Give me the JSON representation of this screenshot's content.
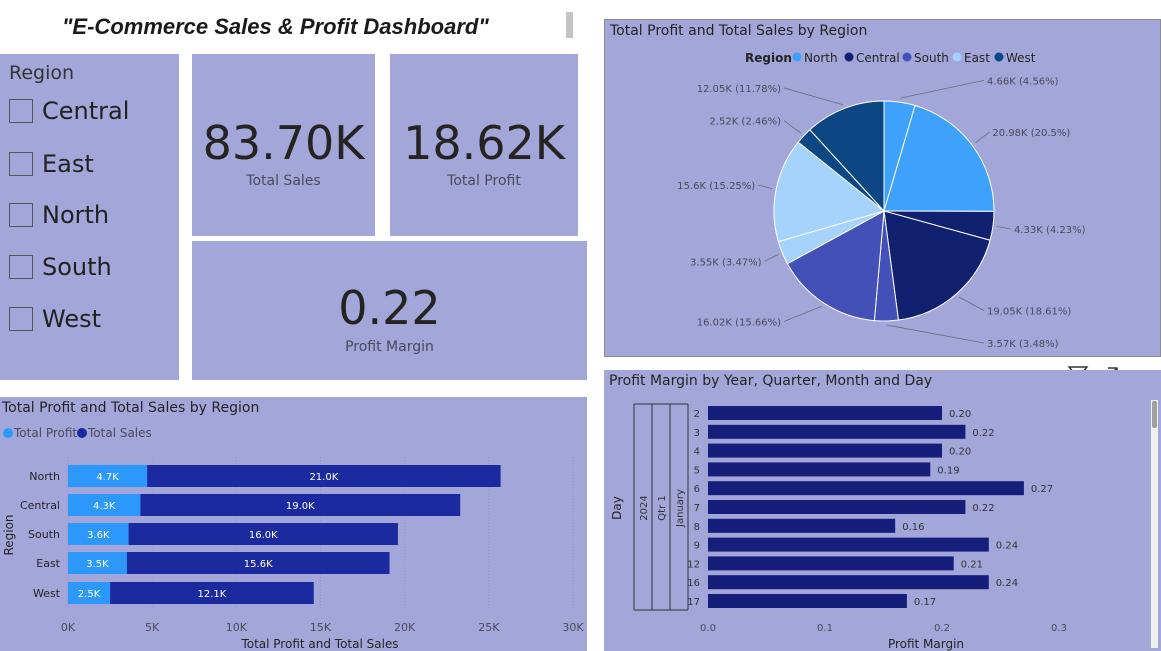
{
  "dashboard_title": "\"E-Commerce Sales & Profit Dashboard\"",
  "slicer": {
    "header": "Region",
    "items": [
      "Central",
      "East",
      "North",
      "South",
      "West"
    ]
  },
  "cards": {
    "total_sales": {
      "value": "83.70K",
      "label": "Total Sales"
    },
    "total_profit": {
      "value": "18.62K",
      "label": "Total Profit"
    },
    "profit_margin": {
      "value": "0.22",
      "label": "Profit Margin"
    }
  },
  "colors": {
    "panel_bg": "#a3a6d9",
    "north": "#3ea1fb",
    "central": "#12216f",
    "south": "#4350b7",
    "east": "#a6d3fc",
    "west": "#0d4783",
    "profit_bar": "#2c98fb",
    "sales_bar": "#1c2aa0",
    "margin_bar": "#151e7a"
  },
  "visual_header_icons": [
    "filter-icon",
    "focus-mode-icon",
    "more-options-icon"
  ],
  "chart_data": [
    {
      "type": "pie",
      "title": "Total Profit and Total Sales by Region",
      "legend_title": "Region",
      "legend_position": "top-center",
      "legend": [
        "North",
        "Central",
        "South",
        "East",
        "West"
      ],
      "slices": [
        {
          "region": "North",
          "measure": "Total Profit",
          "value": 4.66,
          "label": "4.66K (4.56%)",
          "color": "#3ea1fb"
        },
        {
          "region": "North",
          "measure": "Total Sales",
          "value": 20.98,
          "label": "20.98K (20.5%)",
          "color": "#3ea1fb"
        },
        {
          "region": "Central",
          "measure": "Total Profit",
          "value": 4.33,
          "label": "4.33K (4.23%)",
          "color": "#12216f"
        },
        {
          "region": "Central",
          "measure": "Total Sales",
          "value": 19.05,
          "label": "19.05K (18.61%)",
          "color": "#12216f"
        },
        {
          "region": "South",
          "measure": "Total Profit",
          "value": 3.57,
          "label": "3.57K (3.48%)",
          "color": "#4350b7"
        },
        {
          "region": "South",
          "measure": "Total Sales",
          "value": 16.02,
          "label": "16.02K (15.66%)",
          "color": "#4350b7"
        },
        {
          "region": "East",
          "measure": "Total Profit",
          "value": 3.55,
          "label": "3.55K (3.47%)",
          "color": "#a6d3fc"
        },
        {
          "region": "East",
          "measure": "Total Sales",
          "value": 15.6,
          "label": "15.6K (15.25%)",
          "color": "#a6d3fc"
        },
        {
          "region": "West",
          "measure": "Total Profit",
          "value": 2.52,
          "label": "2.52K (2.46%)",
          "color": "#0d4783"
        },
        {
          "region": "West",
          "measure": "Total Sales",
          "value": 12.05,
          "label": "12.05K (11.78%)",
          "color": "#0d4783"
        }
      ]
    },
    {
      "type": "bar",
      "orientation": "horizontal-stacked",
      "title": "Total Profit and Total Sales by Region",
      "legend_position": "top-left",
      "categories": [
        "North",
        "Central",
        "South",
        "East",
        "West"
      ],
      "series": [
        {
          "name": "Total Profit",
          "values": [
            4.7,
            4.3,
            3.6,
            3.5,
            2.5
          ],
          "labels": [
            "4.7K",
            "4.3K",
            "3.6K",
            "3.5K",
            "2.5K"
          ],
          "color": "#2c98fb"
        },
        {
          "name": "Total Sales",
          "values": [
            21.0,
            19.0,
            16.0,
            15.6,
            12.1
          ],
          "labels": [
            "21.0K",
            "19.0K",
            "16.0K",
            "15.6K",
            "12.1K"
          ],
          "color": "#1c2aa0"
        }
      ],
      "xlabel": "Total Profit and Total Sales",
      "ylabel": "Region",
      "xlim": [
        0,
        30
      ],
      "xticks": [
        "0K",
        "5K",
        "10K",
        "15K",
        "20K",
        "25K",
        "30K"
      ]
    },
    {
      "type": "bar",
      "orientation": "horizontal",
      "title": "Profit Margin by Year, Quarter, Month and Day",
      "ylabel": "Day",
      "hierarchy": {
        "year": "2024",
        "quarter": "Qtr 1",
        "month": "January"
      },
      "categories": [
        "2",
        "3",
        "4",
        "5",
        "6",
        "7",
        "8",
        "9",
        "12",
        "16",
        "17"
      ],
      "values": [
        0.2,
        0.22,
        0.2,
        0.19,
        0.27,
        0.22,
        0.16,
        0.24,
        0.21,
        0.24,
        0.17
      ],
      "labels": [
        "0.20",
        "0.22",
        "0.20",
        "0.19",
        "0.27",
        "0.22",
        "0.16",
        "0.24",
        "0.21",
        "0.24",
        "0.17"
      ],
      "xlabel": "Profit Margin",
      "xlim": [
        0,
        0.3
      ],
      "xticks": [
        "0.0",
        "0.1",
        "0.2",
        "0.3"
      ]
    }
  ]
}
